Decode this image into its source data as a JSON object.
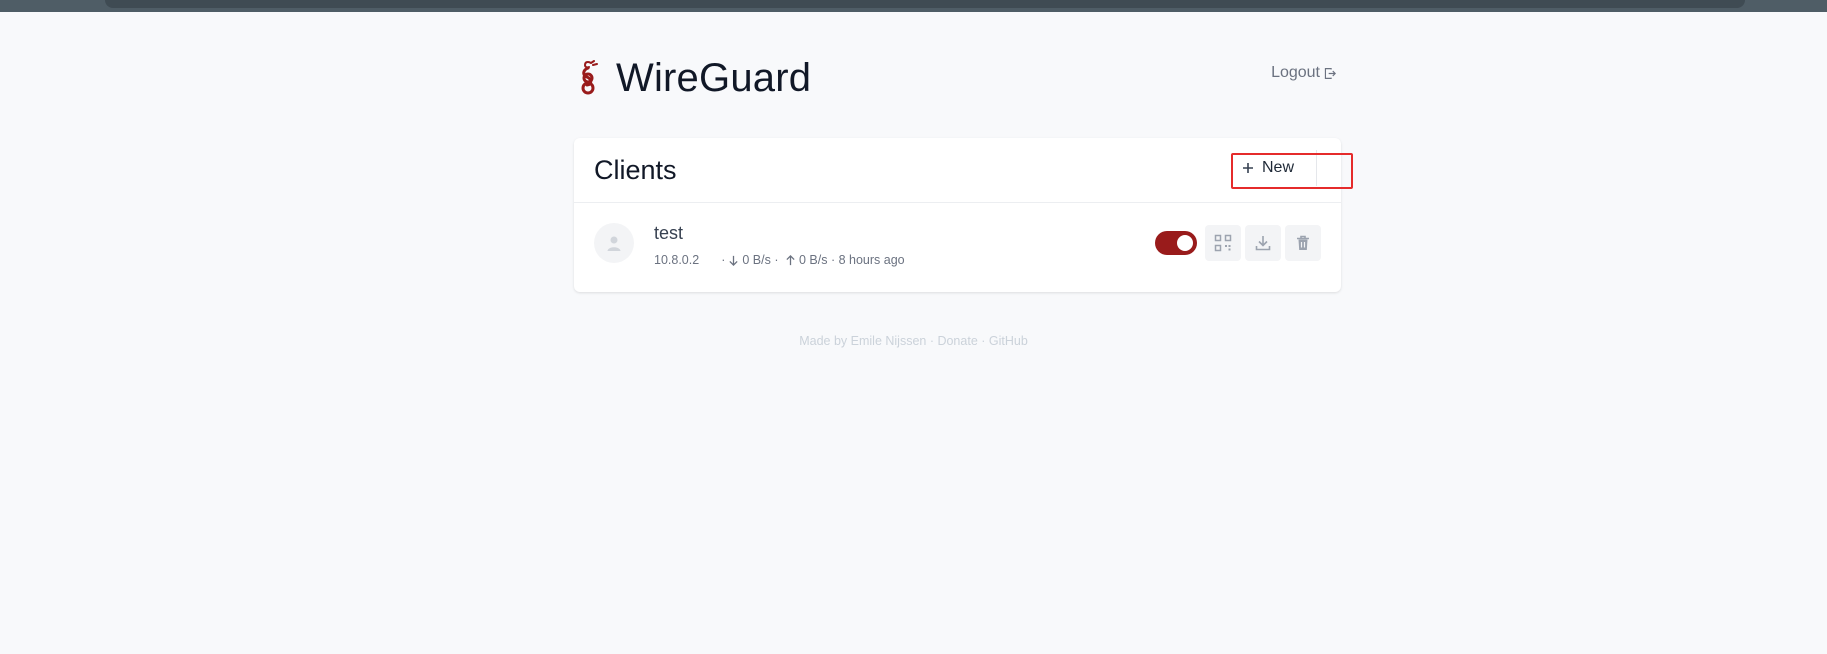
{
  "app": {
    "title": "WireGuard",
    "logout_label": "Logout",
    "colors": {
      "brand": "#991b1b",
      "background": "#f8f9fb",
      "highlight": "#e52b2b"
    }
  },
  "clients": {
    "title": "Clients",
    "new_button_label": "New",
    "items": [
      {
        "name": "test",
        "address": "10.8.0.2",
        "download_rate": "0 B/s",
        "upload_rate": "0 B/s",
        "last_seen": "8 hours ago",
        "enabled": true
      }
    ]
  },
  "footer": {
    "text": "Made by Emile Nijssen · Donate · GitHub"
  },
  "icons": {
    "logo": "wireguard-dragon-logo",
    "logout": "logout-icon",
    "new": "plus-icon",
    "avatar": "user-icon",
    "download_arrow": "arrow-down-icon",
    "upload_arrow": "arrow-up-icon",
    "qr": "qr-code-icon",
    "download_config": "download-icon",
    "delete": "trash-icon"
  }
}
